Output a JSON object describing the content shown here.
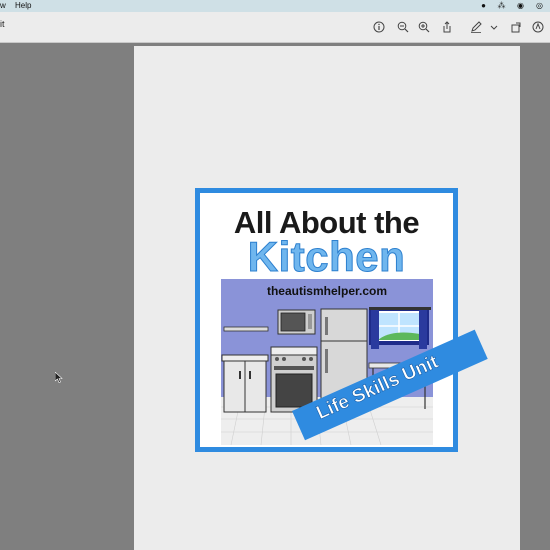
{
  "menubar": {
    "menu_cut": "w",
    "menu_help": "Help"
  },
  "window": {
    "title_fragment": "it"
  },
  "toolbar": {
    "icons": [
      "info-icon",
      "zoom-out-icon",
      "zoom-in-icon",
      "share-icon",
      "markup-pen-icon",
      "chevron-down-icon",
      "rotate-icon",
      "search-icon"
    ]
  },
  "document": {
    "title_line1": "All About the",
    "title_line2": "Kitchen",
    "website": "theautismhelper.com",
    "banner": "Life Skills Unit"
  },
  "colors": {
    "accent_blue": "#2f8be0",
    "kitchen_title_blue": "#6fb6ee",
    "scene_wall": "#8a93d8"
  }
}
